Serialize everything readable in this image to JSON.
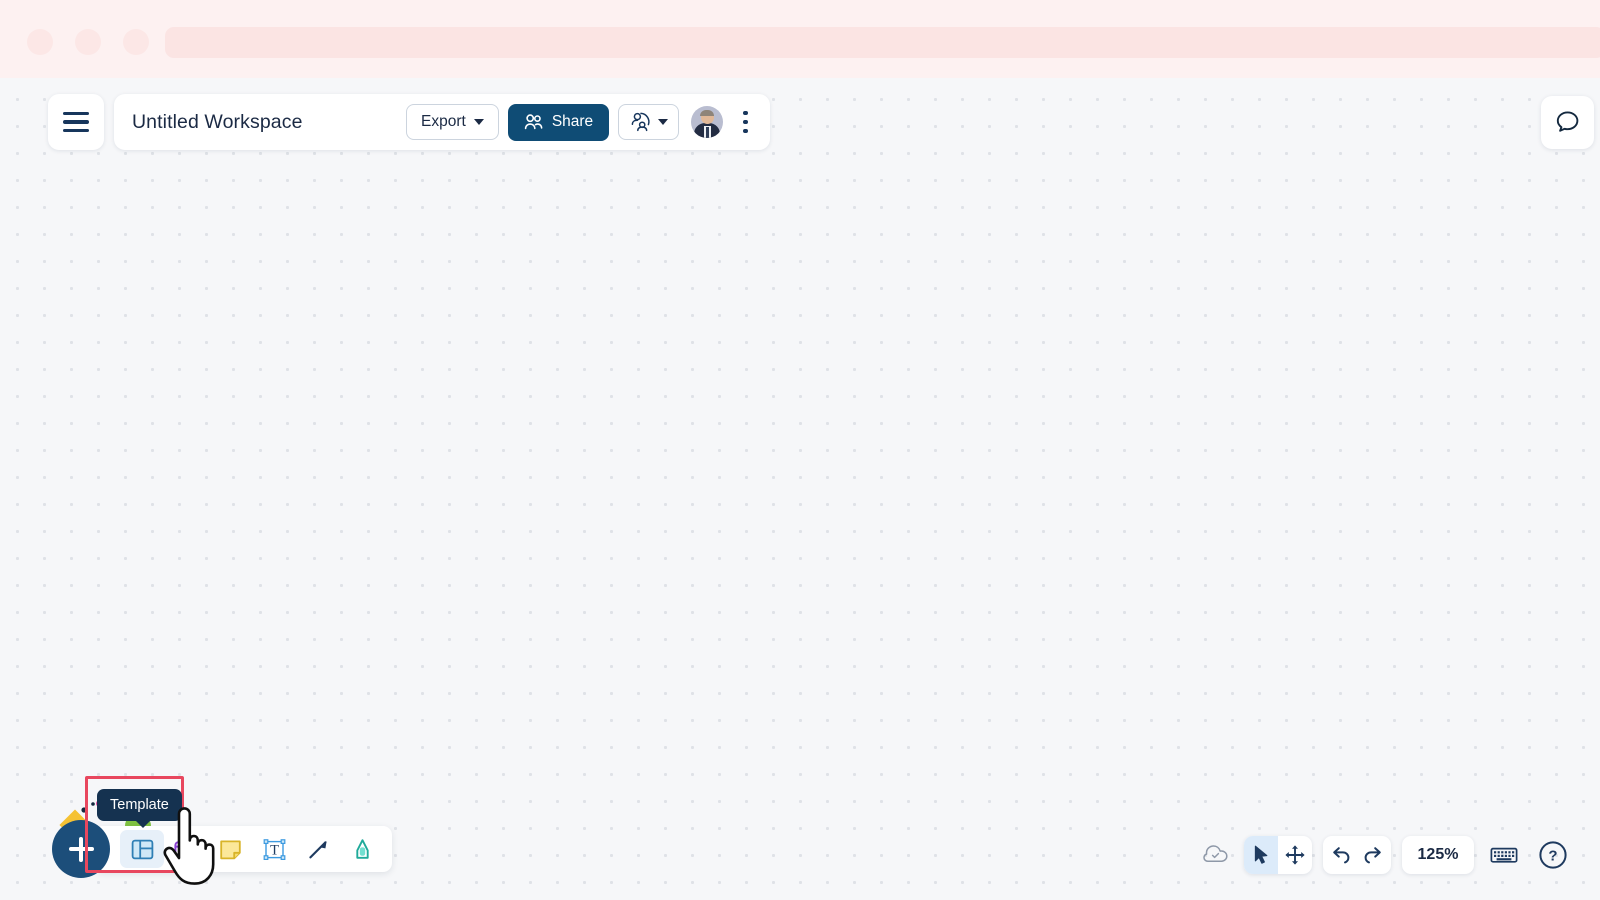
{
  "browser": {
    "traffic_lights": [
      "close-dot",
      "minimize-dot",
      "maximize-dot"
    ],
    "url_bar_value": ""
  },
  "header": {
    "menu_icon": "hamburger-icon",
    "workspace_title": "Untitled Workspace",
    "workspace_title_placeholder": "Untitled Workspace",
    "export_label": "Export",
    "export_caret_icon": "chevron-down-icon",
    "share_label": "Share",
    "share_icon": "people-icon",
    "share_bg": "#0f4c75",
    "permission_icon": "person-access-icon",
    "permission_caret_icon": "chevron-down-icon",
    "avatar_name": "user-avatar",
    "more_icon": "kebab-menu-icon"
  },
  "right_rail": {
    "chat_icon": "chat-bubble-icon"
  },
  "canvas": {
    "background_color": "#f6f7f9",
    "dot_color": "#dfe2e7",
    "dot_spacing_px": 27
  },
  "create_toolbar": {
    "add_label": "+",
    "add_icon": "plus-icon",
    "add_bg": "#1c4e7a",
    "tools": [
      {
        "name": "template-tool",
        "icon": "template-panel-icon",
        "label": "Template",
        "active": true
      },
      {
        "name": "shape-tool",
        "icon": "card-shape-icon",
        "label": "Shape",
        "active": false
      },
      {
        "name": "sticky-note-tool",
        "icon": "sticky-note-icon",
        "label": "Sticky note",
        "active": false
      },
      {
        "name": "text-tool",
        "icon": "text-box-icon",
        "label": "Text",
        "active": false
      },
      {
        "name": "connector-tool",
        "icon": "arrow-icon",
        "label": "Connector",
        "active": false
      },
      {
        "name": "highlighter-tool",
        "icon": "highlighter-pen-icon",
        "label": "Highlighter",
        "active": false
      }
    ],
    "tooltip_text": "Template",
    "tooltip_bg": "#153250",
    "highlight_color": "#e8475e",
    "cursor_icon": "pointing-hand-cursor"
  },
  "bottom_right_controls": {
    "save_status_icon": "cloud-check-icon",
    "select_icon": "cursor-arrow-icon",
    "pan_icon": "move-arrows-icon",
    "undo_icon": "undo-arrow-icon",
    "redo_icon": "redo-arrow-icon",
    "zoom_level": "125%",
    "keyboard_icon": "keyboard-icon",
    "help_icon": "question-circle-icon"
  }
}
